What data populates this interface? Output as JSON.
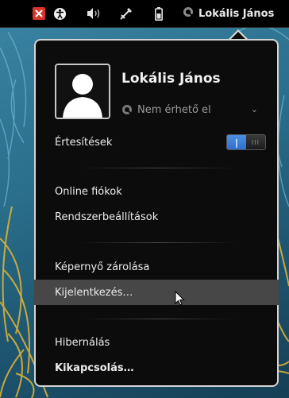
{
  "topbar": {
    "icons": [
      "close-icon",
      "accessibility-icon",
      "volume-icon",
      "network-icon",
      "battery-icon"
    ],
    "user_label": "Lokális János",
    "user_status_icon": "offline-status-icon"
  },
  "menu": {
    "user_name": "Lokális János",
    "status_label": "Nem érhető el",
    "status_icon": "offline-status-icon",
    "notifications_label": "Értesítések",
    "notifications_on": true,
    "items": {
      "online_accounts": "Online fiókok",
      "system_settings": "Rendszerbeállítások",
      "lock_screen": "Képernyő zárolása",
      "log_out": "Kijelentkezés…",
      "hibernate": "Hibernálás",
      "power_off": "Kikapcsolás…"
    },
    "highlighted_item": "log_out"
  },
  "colors": {
    "menu_bg": "#0c0c0c",
    "highlight": "#474747",
    "toggle_on": "#3a7ad8",
    "close_icon": "#d9342b"
  }
}
